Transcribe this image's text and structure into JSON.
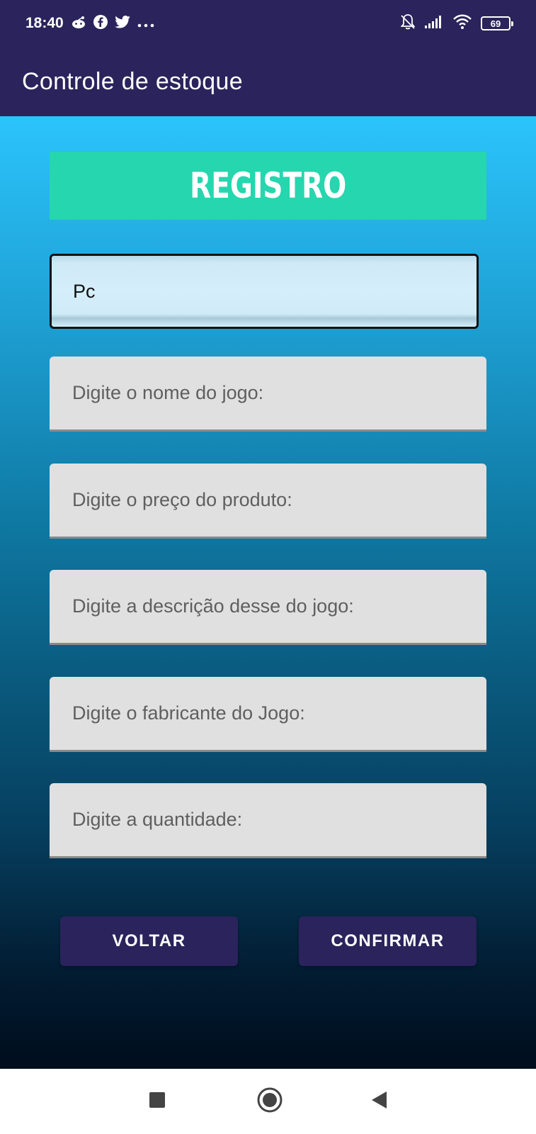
{
  "status_bar": {
    "time": "18:40",
    "left_icons": [
      "reddit-icon",
      "facebook-icon",
      "twitter-icon",
      "more-dots-icon"
    ],
    "right_icons": [
      "bell-off-icon",
      "signal-icon",
      "wifi-icon",
      "battery-icon"
    ],
    "battery_level": "69"
  },
  "app_bar": {
    "title": "Controle de estoque"
  },
  "banner": {
    "title": "REGISTRO"
  },
  "form": {
    "platform_value": "Pc",
    "fields": [
      {
        "placeholder": "Digite o nome do jogo:"
      },
      {
        "placeholder": "Digite o preço do produto:"
      },
      {
        "placeholder": "Digite a descrição desse do jogo:"
      },
      {
        "placeholder": "Digite o fabricante do Jogo:"
      },
      {
        "placeholder": "Digite a quantidade:"
      }
    ]
  },
  "buttons": {
    "back_label": "VOLTAR",
    "confirm_label": "CONFIRMAR"
  },
  "nav_bar": {
    "icons": [
      "recents-square-icon",
      "home-circle-icon",
      "back-triangle-icon"
    ]
  },
  "colors": {
    "primary": "#2a235c",
    "banner": "#26d6ae",
    "gradient_top": "#2bc4fb",
    "gradient_bottom": "#000d1d",
    "field_background": "#e0e0e0"
  }
}
